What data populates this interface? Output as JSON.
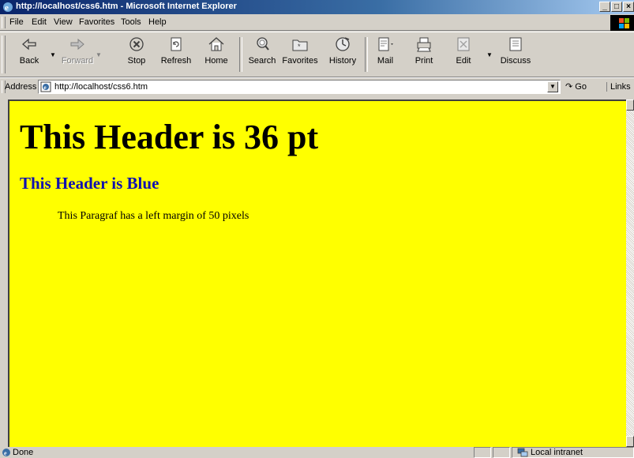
{
  "window": {
    "title": "http://localhost/css6.htm - Microsoft Internet Explorer"
  },
  "menu": [
    {
      "label": "File"
    },
    {
      "label": "Edit"
    },
    {
      "label": "View"
    },
    {
      "label": "Favorites"
    },
    {
      "label": "Tools"
    },
    {
      "label": "Help"
    }
  ],
  "toolbar": {
    "back": "Back",
    "forward": "Forward",
    "stop": "Stop",
    "refresh": "Refresh",
    "home": "Home",
    "search": "Search",
    "favorites": "Favorites",
    "history": "History",
    "mail": "Mail",
    "print": "Print",
    "edit": "Edit",
    "discuss": "Discuss"
  },
  "address": {
    "label": "Address",
    "url": "http://localhost/css6.htm",
    "go": "Go",
    "links": "Links"
  },
  "page": {
    "background": "#ffff00",
    "h1": "This Header is 36 pt",
    "h2": "This Header is Blue",
    "h2_color": "#1010b0",
    "paragraph": "This Paragraf has a left margin of 50 pixels"
  },
  "status": {
    "text": "Done",
    "zone": "Local intranet"
  }
}
